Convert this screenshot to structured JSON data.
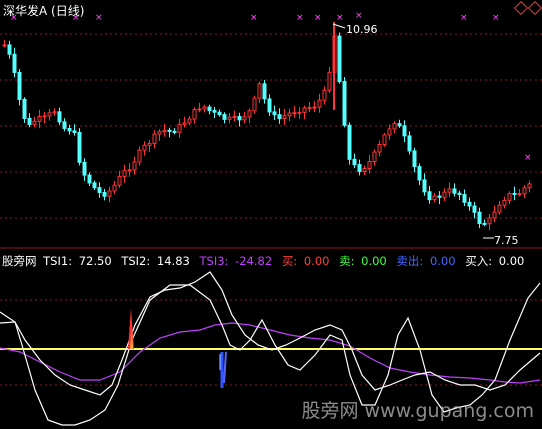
{
  "main_chart": {
    "title": "深华发A (日线)",
    "high_label": "10.96",
    "low_label": "7.75"
  },
  "indicator": {
    "name": "股旁网",
    "tsi1_label": "TSI1:",
    "tsi1_value": "72.50",
    "tsi2_label": "TSI2:",
    "tsi2_value": "14.83",
    "tsi3_label": "TSI3:",
    "tsi3_value": "-24.82",
    "buy_label": "买:",
    "buy_value": "0.00",
    "sell_label": "卖:",
    "sell_value": "0.00",
    "sell_out_label": "卖出:",
    "sell_out_value": "0.00",
    "buy_in_label": "买入:",
    "buy_in_value": "0.00"
  },
  "watermark": "股旁网 www.gupang.com",
  "colors": {
    "up": "#ff3333",
    "down": "#54ffff",
    "tsi1": "#ffffff",
    "tsi2": "#ffffff",
    "tsi3": "#c040ff",
    "baseline": "#ffff66",
    "grid": "#8b1a1a",
    "marker": "#ff55ff"
  }
}
